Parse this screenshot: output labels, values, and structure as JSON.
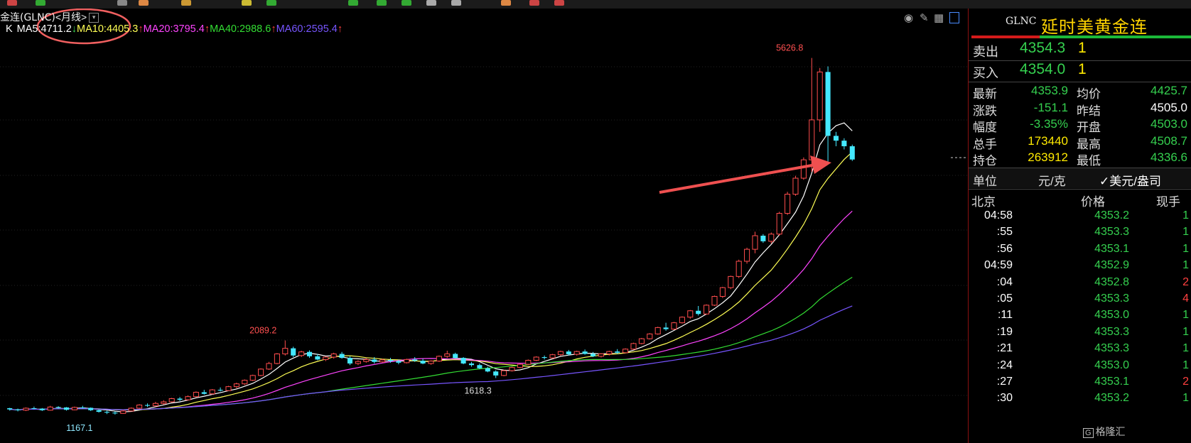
{
  "chart_header": {
    "instrument_label": "金连(GLNC)",
    "period_label": "<月线>",
    "dropdown_icon": "chevron-down-icon",
    "k_label": "K",
    "ma": [
      {
        "label": "MA5:4711.2",
        "arrow": "↓",
        "color": "#ffffff",
        "arrow_color": "#35d04f"
      },
      {
        "label": "MA10:4405.3",
        "arrow": "↑",
        "color": "#ffff55",
        "arrow_color": "#ff4040"
      },
      {
        "label": "MA20:3795.4",
        "arrow": "↑",
        "color": "#ff44ff",
        "arrow_color": "#ff4040"
      },
      {
        "label": "MA40:2988.6",
        "arrow": "↑",
        "color": "#33dd33",
        "arrow_color": "#ff4040"
      },
      {
        "label": "MA60:2595.4",
        "arrow": "↑",
        "color": "#7755ff",
        "arrow_color": "#ff4040"
      }
    ],
    "icons": [
      "eye-slash-icon",
      "pencil-icon",
      "grid-icon",
      "panel-toggle-icon"
    ]
  },
  "annotations": {
    "high": "5626.8",
    "mid_high": "2089.2",
    "mid_low": "1618.3",
    "low": "1167.1"
  },
  "colors": {
    "up": "#ff4d4d",
    "down": "#44e8ff",
    "annotation_circle": "#f06060",
    "arrow": "#ef5050",
    "accent_green": "#35d04f",
    "accent_yellow": "#ffea00"
  },
  "chart_data": {
    "type": "candlestick",
    "title": "",
    "ylim": [
      1000,
      5800
    ],
    "candles": [
      [
        1240,
        1245,
        1210,
        1225
      ],
      [
        1225,
        1235,
        1200,
        1215
      ],
      [
        1215,
        1250,
        1205,
        1240
      ],
      [
        1240,
        1260,
        1225,
        1235
      ],
      [
        1235,
        1242,
        1205,
        1215
      ],
      [
        1215,
        1270,
        1210,
        1255
      ],
      [
        1255,
        1265,
        1235,
        1250
      ],
      [
        1250,
        1255,
        1210,
        1220
      ],
      [
        1220,
        1260,
        1215,
        1250
      ],
      [
        1250,
        1270,
        1235,
        1245
      ],
      [
        1245,
        1250,
        1205,
        1215
      ],
      [
        1215,
        1225,
        1185,
        1195
      ],
      [
        1195,
        1210,
        1167,
        1185
      ],
      [
        1185,
        1200,
        1160,
        1175
      ],
      [
        1175,
        1220,
        1170,
        1205
      ],
      [
        1205,
        1250,
        1200,
        1240
      ],
      [
        1240,
        1290,
        1230,
        1280
      ],
      [
        1280,
        1300,
        1255,
        1270
      ],
      [
        1270,
        1320,
        1260,
        1300
      ],
      [
        1300,
        1340,
        1285,
        1320
      ],
      [
        1320,
        1370,
        1310,
        1360
      ],
      [
        1360,
        1380,
        1330,
        1345
      ],
      [
        1345,
        1400,
        1340,
        1385
      ],
      [
        1385,
        1450,
        1375,
        1440
      ],
      [
        1440,
        1470,
        1410,
        1420
      ],
      [
        1420,
        1480,
        1410,
        1470
      ],
      [
        1470,
        1500,
        1450,
        1460
      ],
      [
        1460,
        1520,
        1455,
        1510
      ],
      [
        1510,
        1560,
        1490,
        1545
      ],
      [
        1545,
        1600,
        1530,
        1590
      ],
      [
        1590,
        1660,
        1580,
        1650
      ],
      [
        1650,
        1740,
        1640,
        1730
      ],
      [
        1730,
        1820,
        1720,
        1800
      ],
      [
        1800,
        1930,
        1790,
        1920
      ],
      [
        1920,
        2089,
        1900,
        1990
      ],
      [
        1990,
        2010,
        1880,
        1900
      ],
      [
        1900,
        1960,
        1880,
        1945
      ],
      [
        1945,
        1965,
        1870,
        1890
      ],
      [
        1890,
        1920,
        1840,
        1850
      ],
      [
        1850,
        1890,
        1830,
        1880
      ],
      [
        1880,
        1935,
        1860,
        1920
      ],
      [
        1920,
        1945,
        1860,
        1870
      ],
      [
        1870,
        1890,
        1780,
        1800
      ],
      [
        1800,
        1840,
        1780,
        1825
      ],
      [
        1825,
        1870,
        1810,
        1850
      ],
      [
        1850,
        1880,
        1800,
        1820
      ],
      [
        1820,
        1860,
        1810,
        1845
      ],
      [
        1845,
        1870,
        1810,
        1830
      ],
      [
        1830,
        1850,
        1790,
        1810
      ],
      [
        1810,
        1860,
        1800,
        1850
      ],
      [
        1850,
        1880,
        1820,
        1835
      ],
      [
        1835,
        1860,
        1790,
        1800
      ],
      [
        1800,
        1840,
        1785,
        1830
      ],
      [
        1830,
        1900,
        1820,
        1890
      ],
      [
        1890,
        1960,
        1870,
        1920
      ],
      [
        1920,
        1935,
        1860,
        1870
      ],
      [
        1870,
        1880,
        1790,
        1800
      ],
      [
        1800,
        1820,
        1760,
        1780
      ],
      [
        1780,
        1800,
        1730,
        1740
      ],
      [
        1740,
        1760,
        1690,
        1700
      ],
      [
        1700,
        1715,
        1618,
        1650
      ],
      [
        1650,
        1720,
        1640,
        1710
      ],
      [
        1710,
        1760,
        1700,
        1750
      ],
      [
        1750,
        1800,
        1740,
        1790
      ],
      [
        1790,
        1850,
        1780,
        1840
      ],
      [
        1840,
        1890,
        1830,
        1880
      ],
      [
        1880,
        1900,
        1850,
        1870
      ],
      [
        1870,
        1920,
        1860,
        1910
      ],
      [
        1910,
        1960,
        1895,
        1950
      ],
      [
        1950,
        1970,
        1900,
        1915
      ],
      [
        1915,
        1960,
        1900,
        1950
      ],
      [
        1950,
        1975,
        1910,
        1920
      ],
      [
        1920,
        1945,
        1880,
        1890
      ],
      [
        1890,
        1930,
        1875,
        1920
      ],
      [
        1920,
        1960,
        1900,
        1950
      ],
      [
        1950,
        1980,
        1920,
        1935
      ],
      [
        1935,
        1990,
        1930,
        1980
      ],
      [
        1980,
        2060,
        1970,
        2050
      ],
      [
        2050,
        2120,
        2040,
        2110
      ],
      [
        2110,
        2180,
        2100,
        2170
      ],
      [
        2170,
        2260,
        2160,
        2250
      ],
      [
        2250,
        2310,
        2210,
        2230
      ],
      [
        2230,
        2320,
        2220,
        2310
      ],
      [
        2310,
        2390,
        2300,
        2380
      ],
      [
        2380,
        2470,
        2360,
        2460
      ],
      [
        2460,
        2520,
        2400,
        2420
      ],
      [
        2420,
        2540,
        2410,
        2530
      ],
      [
        2530,
        2650,
        2520,
        2640
      ],
      [
        2640,
        2760,
        2620,
        2750
      ],
      [
        2750,
        2900,
        2730,
        2890
      ],
      [
        2890,
        3100,
        2870,
        3080
      ],
      [
        3080,
        3250,
        3050,
        3230
      ],
      [
        3230,
        3450,
        3180,
        3400
      ],
      [
        3400,
        3420,
        3310,
        3330
      ],
      [
        3330,
        3440,
        3300,
        3420
      ],
      [
        3420,
        3700,
        3400,
        3680
      ],
      [
        3680,
        3950,
        3660,
        3920
      ],
      [
        3920,
        4150,
        3900,
        4120
      ],
      [
        4120,
        4380,
        4100,
        4350
      ],
      [
        4350,
        5626,
        4200,
        4850
      ],
      [
        4850,
        5500,
        4700,
        5450
      ],
      [
        5450,
        5520,
        4330,
        4650
      ],
      [
        4650,
        4700,
        4520,
        4590
      ],
      [
        4590,
        4620,
        4480,
        4520
      ],
      [
        4520,
        4540,
        4336,
        4354
      ]
    ],
    "ma_series": [
      {
        "name": "MA5",
        "color": "#ffffff",
        "last": 4711.2
      },
      {
        "name": "MA10",
        "color": "#ffff55",
        "last": 4405.3
      },
      {
        "name": "MA20",
        "color": "#ff44ff",
        "last": 3795.4
      },
      {
        "name": "MA40",
        "color": "#33dd33",
        "last": 2988.6
      },
      {
        "name": "MA60",
        "color": "#7755ff",
        "last": 2595.4
      }
    ]
  },
  "quote_panel": {
    "code": "GLNC",
    "name": "延时美黄金连",
    "sell": {
      "label": "卖出",
      "price": "4354.3",
      "qty": "1"
    },
    "buy": {
      "label": "买入",
      "price": "4354.0",
      "qty": "1"
    },
    "stats_left": [
      {
        "label": "最新",
        "value": "4353.9",
        "color": "green"
      },
      {
        "label": "涨跌",
        "value": "-151.1",
        "color": "green"
      },
      {
        "label": "幅度",
        "value": "-3.35%",
        "color": "green"
      },
      {
        "label": "总手",
        "value": "173440",
        "color": "yellow"
      },
      {
        "label": "持仓",
        "value": "263912",
        "color": "yellow"
      }
    ],
    "stats_right": [
      {
        "label": "均价",
        "value": "4425.7",
        "color": "green"
      },
      {
        "label": "昨结",
        "value": "4505.0",
        "color": "white"
      },
      {
        "label": "开盘",
        "value": "4503.0",
        "color": "green"
      },
      {
        "label": "最高",
        "value": "4508.7",
        "color": "green"
      },
      {
        "label": "最低",
        "value": "4336.6",
        "color": "green"
      }
    ],
    "unit": {
      "label": "单位",
      "option1": "元/克",
      "option2": "✓美元/盎司"
    },
    "ticks_header": {
      "time": "北京",
      "price": "价格",
      "qty": "现手"
    },
    "ticks": [
      {
        "time": "04:58",
        "price": "4353.2",
        "qty": "1"
      },
      {
        "time": ":55",
        "price": "4353.3",
        "qty": "1"
      },
      {
        "time": ":56",
        "price": "4353.1",
        "qty": "1"
      },
      {
        "time": "04:59",
        "price": "4352.9",
        "qty": "1"
      },
      {
        "time": ":04",
        "price": "4352.8",
        "qty": "2"
      },
      {
        "time": ":05",
        "price": "4353.3",
        "qty": "4"
      },
      {
        "time": ":11",
        "price": "4353.0",
        "qty": "1"
      },
      {
        "time": ":19",
        "price": "4353.3",
        "qty": "1"
      },
      {
        "time": ":21",
        "price": "4353.3",
        "qty": "1"
      },
      {
        "time": ":24",
        "price": "4353.0",
        "qty": "1"
      },
      {
        "time": ":27",
        "price": "4353.1",
        "qty": "2"
      },
      {
        "time": ":30",
        "price": "4353.2",
        "qty": "1"
      }
    ],
    "watermark": "格隆汇"
  }
}
